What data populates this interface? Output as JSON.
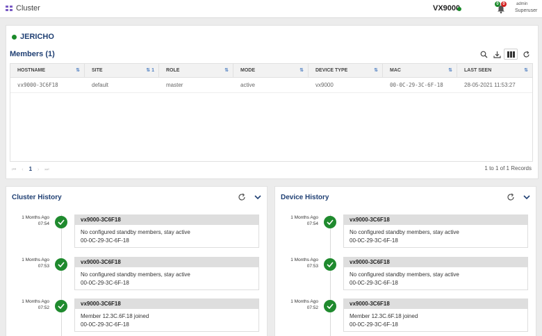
{
  "topbar": {
    "app_title": "Cluster",
    "device_name": "VX9000",
    "badge_green": "0",
    "badge_red": "0",
    "user_name": "admin",
    "user_role": "Superuser"
  },
  "cluster": {
    "name": "JERICHO",
    "members_title": "Members (1)"
  },
  "table": {
    "columns": [
      "HOSTNAME",
      "SITE",
      "ROLE",
      "MODE",
      "DEVICE TYPE",
      "MAC",
      "LAST SEEN"
    ],
    "site_sort": "⇅ 1",
    "rows": [
      [
        "vx9000-3C6F18",
        "default",
        "master",
        "active",
        "vx9000",
        "00-0C-29-3C-6F-18",
        "28-05-2021 11:53:27"
      ]
    ]
  },
  "pager": {
    "current": "1",
    "records": "1 to 1 of 1 Records"
  },
  "cluster_history": {
    "title": "Cluster History",
    "entries": [
      {
        "ago": "1 Months Ago",
        "time": "07:54",
        "host": "vx9000-3C6F18",
        "message": "No configured standby members, stay active",
        "mac": "00-0C-29-3C-6F-18"
      },
      {
        "ago": "1 Months Ago",
        "time": "07:53",
        "host": "vx9000-3C6F18",
        "message": "No configured standby members, stay active",
        "mac": "00-0C-29-3C-6F-18"
      },
      {
        "ago": "1 Months Ago",
        "time": "07:52",
        "host": "vx9000-3C6F18",
        "message": "Member 12.3C.6F.18 joined",
        "mac": "00-0C-29-3C-6F-18"
      }
    ]
  },
  "device_history": {
    "title": "Device History",
    "entries": [
      {
        "ago": "1 Months Ago",
        "time": "07:54",
        "host": "vx9000-3C6F18",
        "message": "No configured standby members, stay active",
        "mac": "00-0C-29-3C-6F-18"
      },
      {
        "ago": "1 Months Ago",
        "time": "07:53",
        "host": "vx9000-3C6F18",
        "message": "No configured standby members, stay active",
        "mac": "00-0C-29-3C-6F-18"
      },
      {
        "ago": "1 Months Ago",
        "time": "07:52",
        "host": "vx9000-3C6F18",
        "message": "Member 12.3C.6F.18 joined",
        "mac": "00-0C-29-3C-6F-18"
      }
    ]
  },
  "colors": {
    "accent": "#1f3f73",
    "success": "#1f8a2e",
    "alert": "#d32020"
  }
}
